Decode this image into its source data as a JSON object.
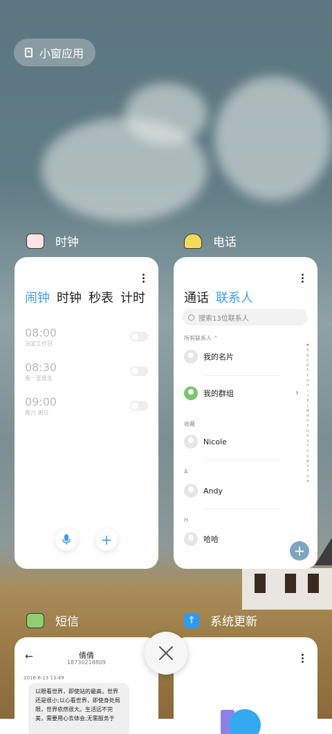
{
  "small_window_button": {
    "label": "小窗应用"
  },
  "clock_app": {
    "title": "时钟",
    "tabs": [
      "闹钟",
      "时钟",
      "秒表",
      "计时"
    ],
    "alarms": [
      {
        "time": "08:00",
        "repeat": "法定工作日"
      },
      {
        "time": "08:30",
        "repeat": "周一至周五"
      },
      {
        "time": "09:00",
        "repeat": "周六 周日"
      }
    ]
  },
  "phone_app": {
    "title": "电话",
    "tabs": [
      "通话",
      "联系人"
    ],
    "search_placeholder": "搜索13位联系人",
    "all_contacts_label": "所有联系人",
    "contacts": {
      "my_card": "我的名片",
      "my_groups": "我的群组",
      "favorites_label": "收藏",
      "favorite": "Nicole",
      "section_a": "A",
      "contact_a": "Andy",
      "section_h": "H",
      "contact_h": "哈哈"
    },
    "alphabet": [
      "♥",
      "A",
      "B",
      "C",
      "D",
      "E",
      "F",
      "G",
      "H",
      "I",
      "J",
      "K",
      "L",
      "M",
      "N",
      "O",
      "P",
      "Q",
      "R",
      "S",
      "T",
      "U",
      "V",
      "W",
      "X",
      "Y",
      "Z",
      "#"
    ]
  },
  "sms_app": {
    "title": "短信",
    "contact_name": "倩倩",
    "contact_number": "18730218809",
    "timestamp": "2016-6-13 13:49",
    "message": "以眼看世界，即使站的最高，世界还是很小;以心看世界，即使身处局限，世界依然很大。生活远不完美，需要用心去体会;无需服务于"
  },
  "update_app": {
    "title": "系统更新"
  },
  "colors": {
    "accent": "#3e9ef4",
    "fab_blue": "#7ea5c0",
    "group_green": "#7cc66f"
  }
}
